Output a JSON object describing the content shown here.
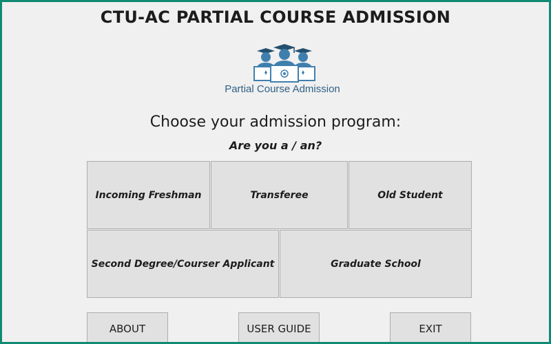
{
  "header": {
    "title": "CTU-AC PARTIAL COURSE ADMISSION"
  },
  "logo": {
    "icon": "students-graduation-icon",
    "caption": "Partial Course Admission",
    "colors": {
      "primary": "#3f7fae",
      "dark": "#24506f",
      "light": "#c9dcea"
    }
  },
  "main": {
    "prompt": "Choose your admission program:",
    "subprompt": "Are you a / an?",
    "programs": [
      "Incoming Freshman",
      "Transferee",
      "Old Student",
      "Second Degree/Courser Applicant",
      "Graduate School"
    ]
  },
  "footer": {
    "about_label": "ABOUT",
    "guide_label": "USER GUIDE",
    "exit_label": "EXIT"
  },
  "theme": {
    "border_color": "#0f8a72",
    "background": "#f0f0f0",
    "button_face": "#e1e1e1"
  }
}
